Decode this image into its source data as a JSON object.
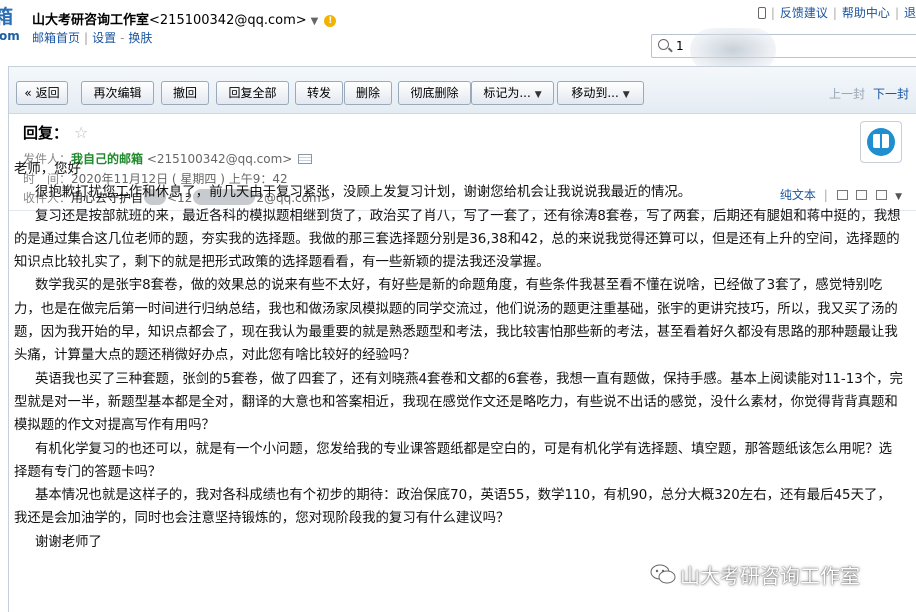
{
  "topbar": {
    "logo_top": "箱",
    "logo_bottom": "om",
    "account_name": "山大考研咨询工作室",
    "account_email": "<215100342@qq.com>",
    "links": [
      "邮箱首页",
      "设置",
      "换肤"
    ],
    "right_links": [
      "反馈建议",
      "帮助中心",
      "退"
    ],
    "search_value": "1"
  },
  "toolbar": {
    "buttons": [
      "« 返回",
      "再次编辑",
      "撤回",
      "回复全部",
      "转发",
      "删除",
      "彻底删除",
      "标记为...",
      "移动到..."
    ],
    "prev": "上一封",
    "next": "下一封"
  },
  "header": {
    "subject": "回复：",
    "sender_label": "发件人：",
    "sender_name": "我自己的邮箱",
    "sender_email": "<215100342@qq.com>",
    "time_label": "时　间：",
    "time_value": "2020年11月12日 ( 星期四 ) 上午9：42",
    "to_label": "收件人：",
    "to_name": "用心去守护自",
    "to_email_start": "<12",
    "to_email_end": "2@qq.com>",
    "plain_text": "纯文本"
  },
  "body": {
    "greeting": "老师，您好",
    "paragraphs": [
      "很抱歉打扰您工作和休息了，前几天由于复习紧张，没顾上发复习计划，谢谢您给机会让我说说我最近的情况。",
      "复习还是按部就班的来，最近各科的模拟题相继到货了，政治买了肖八，写了一套了，还有徐涛8套卷，写了两套，后期还有腿姐和蒋中挺的，我想的是通过集合这几位老师的题，夯实我的选择题。我做的那三套选择题分别是36,38和42，总的来说我觉得还算可以，但是还有上升的空间，选择题的知识点比较扎实了，剩下的就是把形式政策的选择题看看，有一些新颖的提法我还没掌握。",
      "数学我买的是张宇8套卷，做的效果总的说来有些不太好，有好些是新的命题角度，有些条件我甚至看不懂在说啥，已经做了3套了，感觉特别吃力，也是在做完后第一时间进行归纳总结，我也和做汤家凤模拟题的同学交流过，他们说汤的题更注重基础，张宇的更讲究技巧，所以，我又买了汤的题，因为我开始的早，知识点都会了，现在我认为最重要的就是熟悉题型和考法，我比较害怕那些新的考法，甚至看着好久都没有思路的那种题最让我头痛，计算量大点的题还稍微好办点，对此您有啥比较好的经验吗？",
      "英语我也买了三种套题，张剑的5套卷，做了四套了，还有刘晓燕4套卷和文都的6套卷，我想一直有题做，保持手感。基本上阅读能对11-13个，完型就是对一半，新题型基本都是全对，翻译的大意也和答案相近，我现在感觉作文还是略吃力，有些说不出话的感觉，没什么素材，你觉得背背真题和模拟题的作文对提高写作有用吗？",
      "有机化学复习的也还可以，就是有一个小问题，您发给我的专业课答题纸都是空白的，可是有机化学有选择题、填空题，那答题纸该怎么用呢？选择题有专门的答题卡吗？",
      "基本情况也就是这样子的，我对各科成绩也有个初步的期待：政治保底70，英语55，数学110，有机90，总分大概320左右，还有最后45天了，我还是会加油学的，同时也会注意坚持锻炼的，您对现阶段我的复习有什么建议吗？",
      "谢谢老师了"
    ]
  },
  "watermark": {
    "text": "山大考研咨询工作室"
  }
}
